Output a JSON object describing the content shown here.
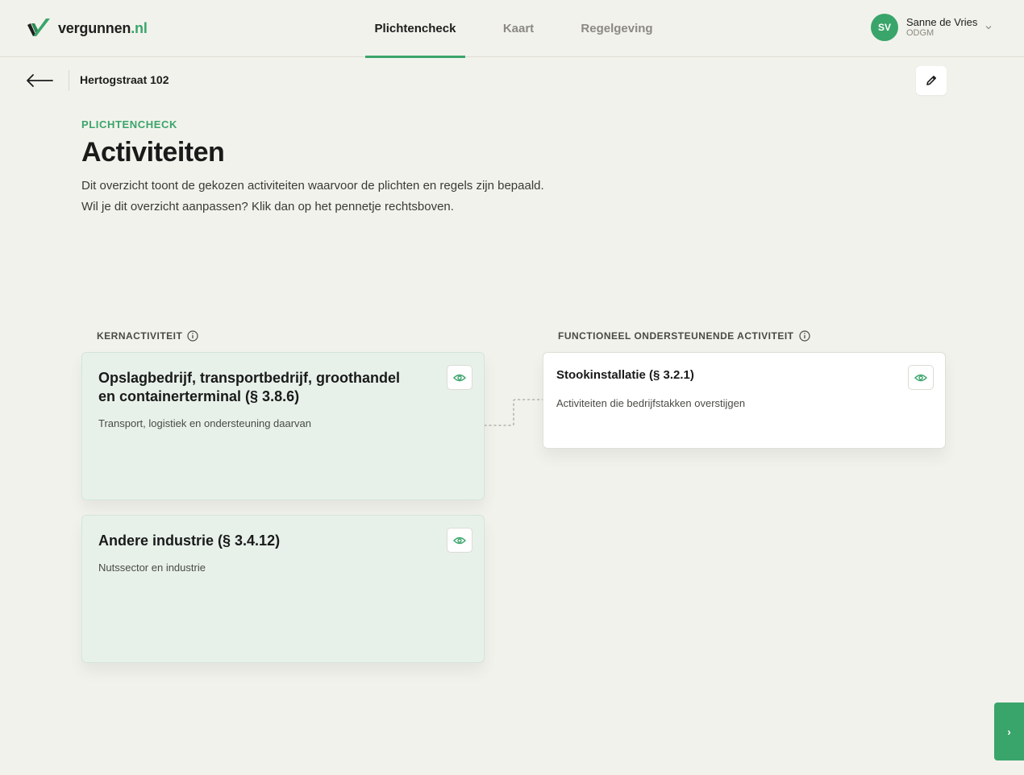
{
  "brand": {
    "name": "vergunnen",
    "tld": ".nl"
  },
  "nav": {
    "tabs": [
      {
        "label": "Plichtencheck",
        "active": true
      },
      {
        "label": "Kaart",
        "active": false
      },
      {
        "label": "Regelgeving",
        "active": false
      }
    ]
  },
  "user": {
    "initials": "SV",
    "name": "Sanne de Vries",
    "org": "ODGM"
  },
  "subheader": {
    "address": "Hertogstraat 102"
  },
  "intro": {
    "eyebrow": "PLICHTENCHECK",
    "title": "Activiteiten",
    "text": "Dit overzicht toont de gekozen activiteiten waarvoor de plichten en regels zijn bepaald. Wil je dit overzicht aanpassen? Klik dan op het pennetje rechtsboven."
  },
  "sections": {
    "core_label": "KERNACTIVITEIT",
    "support_label": "FUNCTIONEEL ONDERSTEUNENDE ACTIVITEIT"
  },
  "cards": {
    "core": [
      {
        "title": "Opslagbedrijf, transportbedrijf, groothandel en containerterminal (§ 3.8.6)",
        "description": "Transport, logistiek en ondersteuning daarvan"
      },
      {
        "title": "Andere industrie (§ 3.4.12)",
        "description": "Nutssector en industrie"
      }
    ],
    "support": [
      {
        "title": "Stookinstallatie (§ 3.2.1)",
        "description": "Activiteiten die bedrijfstakken overstijgen"
      }
    ]
  },
  "next_label": "›",
  "colors": {
    "accent": "#3aa56a",
    "background": "#f2f2ec",
    "core_card": "#e7f1ea"
  }
}
